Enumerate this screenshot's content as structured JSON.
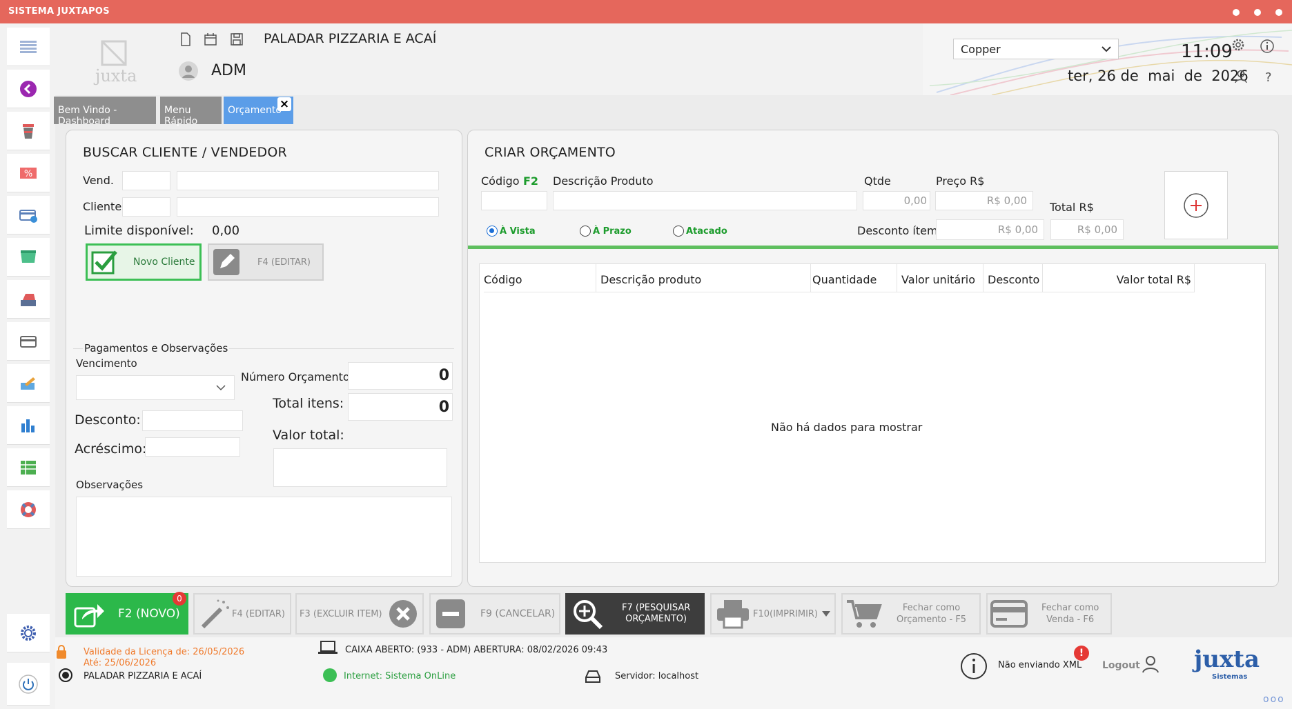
{
  "window": {
    "title": "SISTEMA JUXTAPOS"
  },
  "header": {
    "logo_text": "juxta",
    "company": "PALADAR PIZZARIA E ACAÍ",
    "user": "ADM",
    "theme_selected": "Copper",
    "time": "11:09",
    "date": "ter, 26 de  mai  de  2026"
  },
  "tabs": [
    {
      "label": "Bem Vindo - Dashboard",
      "color": "#8e8e8e"
    },
    {
      "label": "Menu Rápido",
      "color": "#8e8e8e"
    },
    {
      "label": "Orçamento",
      "color": "#5b9de8"
    }
  ],
  "tab_close": "×",
  "buscar": {
    "title": "BUSCAR CLIENTE / VENDEDOR",
    "vend_label": "Vend.",
    "cliente_label": "Cliente",
    "limite_label": "Limite disponível:",
    "limite_value": "0,00",
    "novo_cliente": "Novo Cliente",
    "editar": "F4 (EDITAR)",
    "pagamentos_label": "Pagamentos e Observações",
    "vencimento_label": "Vencimento",
    "numero_orcamento_label": "Número Orçamento",
    "numero_orcamento_value": "0",
    "total_itens_label": "Total itens:",
    "total_itens_value": "0",
    "desconto_label": "Desconto:",
    "acrescimo_label": "Acréscimo:",
    "valor_total_label": "Valor total:",
    "observacoes_label": "Observações"
  },
  "criar": {
    "title": "CRIAR ORÇAMENTO",
    "codigo_label": "Código",
    "codigo_key": "F2",
    "descricao_label": "Descrição Produto",
    "qtde_label": "Qtde",
    "qtde_value": "0,00",
    "preco_label": "Preço R$",
    "preco_value": "R$ 0,00",
    "total_label": "Total R$",
    "total_value": "R$ 0,00",
    "desconto_item_label": "Desconto ítem",
    "desconto_item_value": "R$ 0,00",
    "radios": [
      "À Vista",
      "À Prazo",
      "Atacado"
    ],
    "selected_radio": "À Vista"
  },
  "grid": {
    "columns": [
      "Código",
      "Descrição produto",
      "Quantidade",
      "Valor unitário",
      "Desconto",
      "Valor total R$"
    ],
    "empty_text": "Não há dados para mostrar"
  },
  "toolbar": {
    "novo": "F2 (NOVO)",
    "novo_badge": "0",
    "editar": "F4 (EDITAR)",
    "excluir": "F3 (EXCLUIR ITEM)",
    "cancelar": "F9 (CANCELAR)",
    "pesquisar_1": "F7 (PESQUISAR",
    "pesquisar_2": "ORÇAMENTO)",
    "imprimir": "F10(IMPRIMIR)",
    "fechar_orc_1": "Fechar como",
    "fechar_orc_2": "Orçamento - F5",
    "fechar_venda_1": "Fechar como",
    "fechar_venda_2": "Venda - F6"
  },
  "status": {
    "licenca_1": "Validade da Licença de: 26/05/2026",
    "licenca_2": "Até: 25/06/2026",
    "empresa": "PALADAR PIZZARIA E ACAÍ",
    "caixa": "CAIXA ABERTO: (933 - ADM) ABERTURA: 08/02/2026 09:43",
    "internet": "Internet: Sistema OnLine",
    "servidor": "Servidor: localhost",
    "xml": "Não enviando XML",
    "xml_badge": "!",
    "logout": "Logout",
    "brand": "juxta",
    "brand_sub": "Sistemas"
  },
  "colors": {
    "accent_green": "#3cbf55",
    "title_bar": "#e5675c",
    "tab_active": "#5b9de8"
  }
}
